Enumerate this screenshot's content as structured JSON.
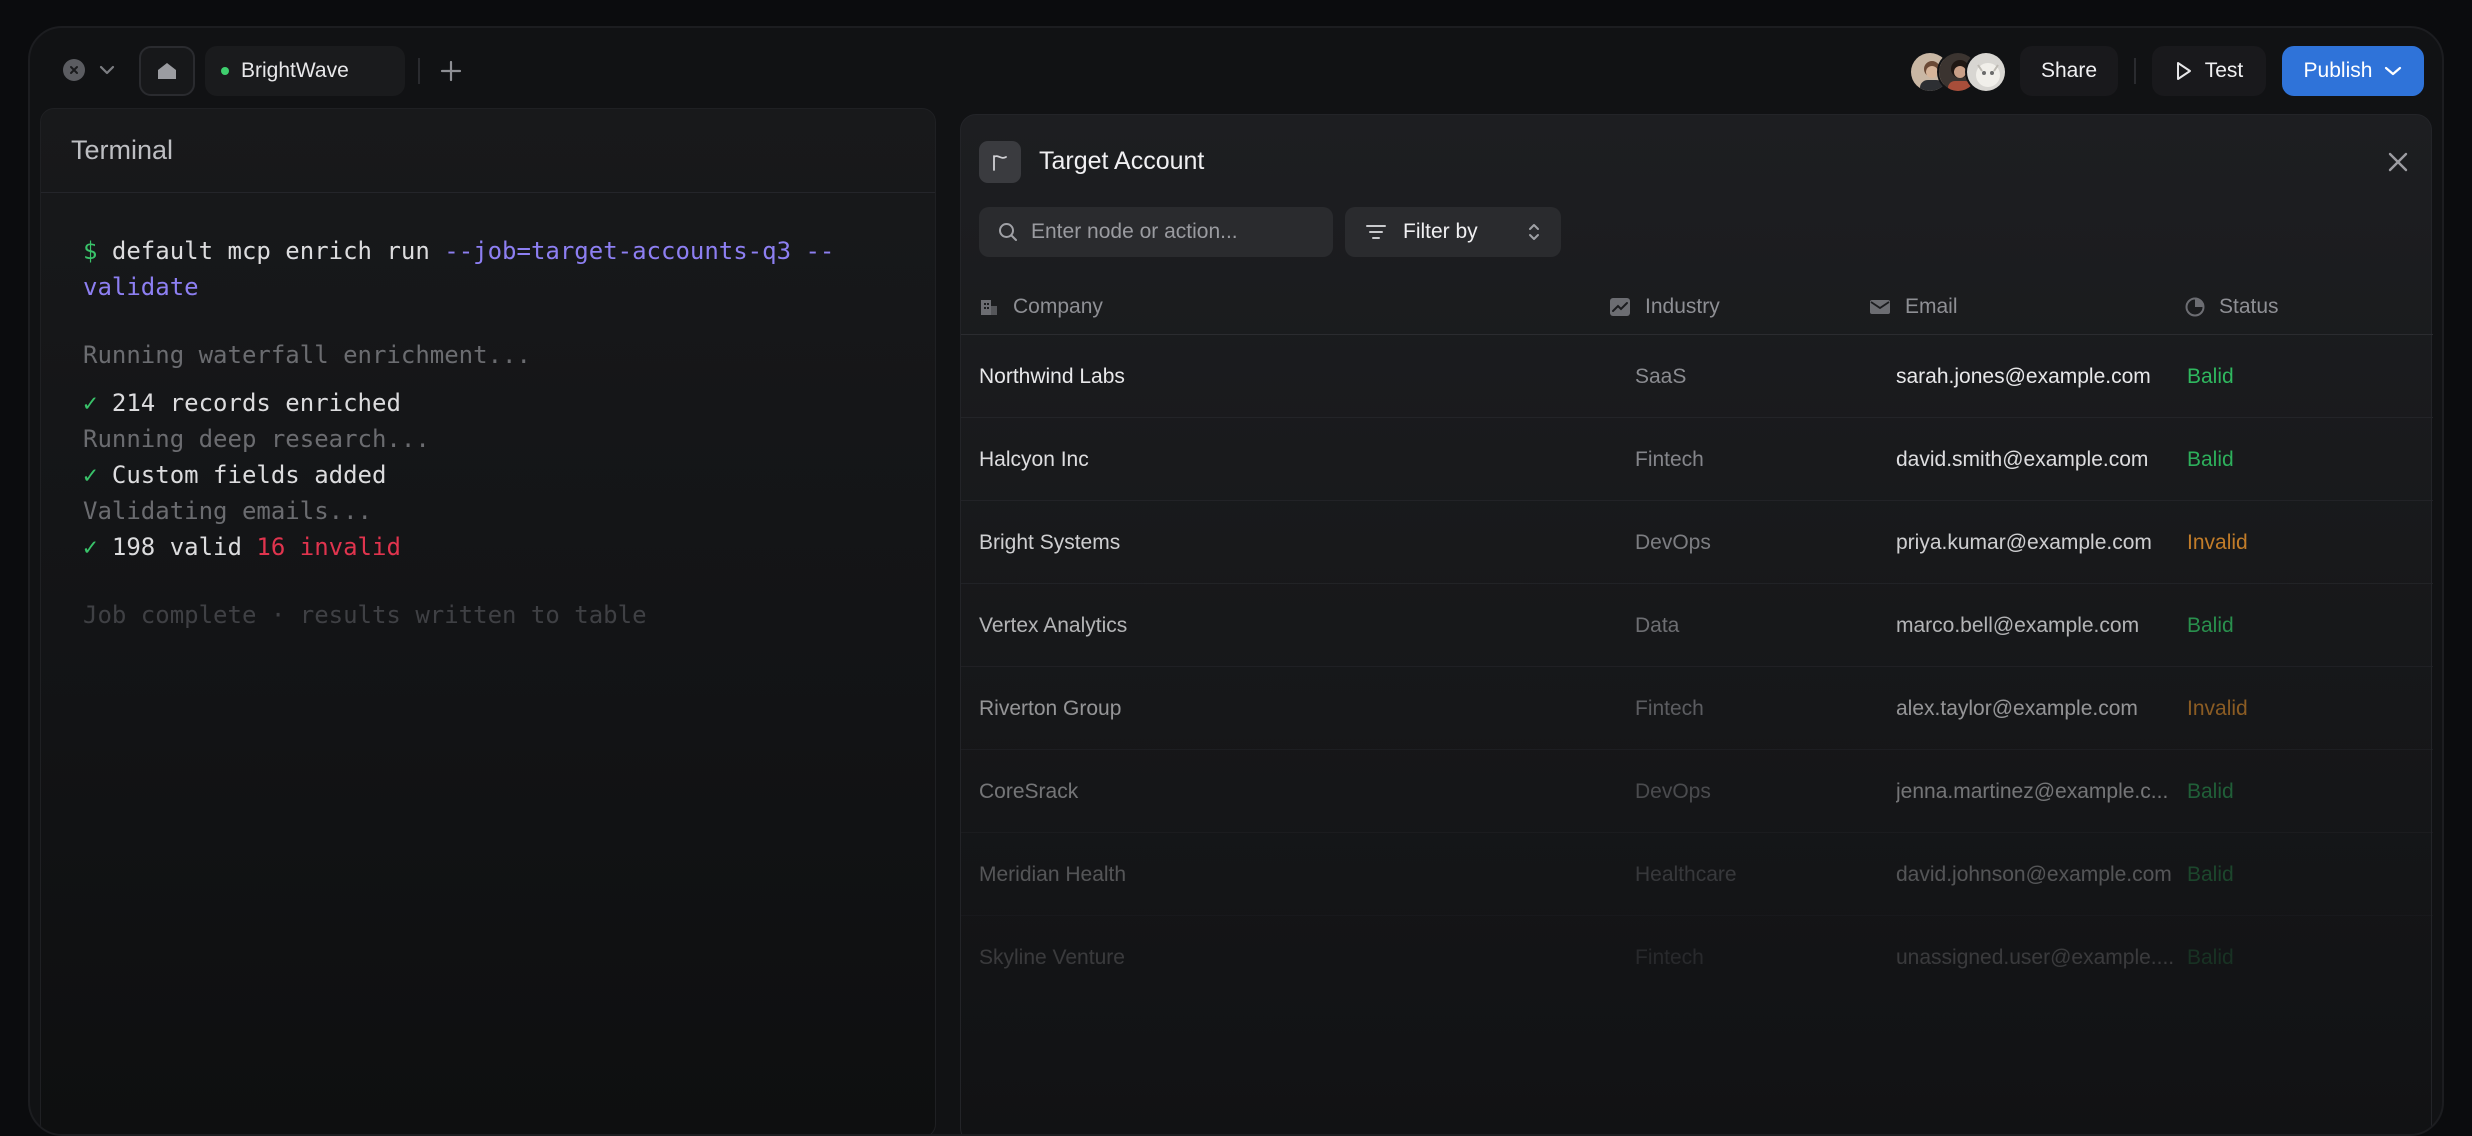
{
  "titlebar": {
    "tab_label": "BrightWave",
    "share_label": "Share",
    "test_label": "Test",
    "publish_label": "Publish"
  },
  "colors": {
    "accent": "#2f73d9",
    "status_valid": "#2fb85f",
    "status_invalid": "#d98a2b",
    "terminal_prompt": "#39c36a",
    "terminal_flag": "#8d7ff2",
    "terminal_error": "#e0344e"
  },
  "terminal": {
    "title": "Terminal",
    "prompt": "$",
    "command": "default mcp enrich run",
    "command_flags": "--job=target-accounts-q3 --validate",
    "line1": "Running waterfall enrichment...",
    "check1": "214 records enriched",
    "line2": "Running deep research...",
    "check2": "Custom fields added",
    "line3": "Validating emails...",
    "check3_valid": "198 valid",
    "check3_invalid": "16 invalid",
    "footer": "Job complete · results written to table"
  },
  "panel": {
    "title": "Target Account",
    "search_placeholder": "Enter node or action...",
    "filter_label": "Filter by",
    "columns": {
      "company": "Company",
      "industry": "Industry",
      "email": "Email",
      "status": "Status"
    },
    "rows": [
      {
        "company": "Northwind Labs",
        "industry": "SaaS",
        "email": "sarah.jones@example.com",
        "status": "Balid"
      },
      {
        "company": "Halcyon Inc",
        "industry": "Fintech",
        "email": "david.smith@example.com",
        "status": "Balid"
      },
      {
        "company": "Bright Systems",
        "industry": "DevOps",
        "email": "priya.kumar@example.com",
        "status": "Invalid"
      },
      {
        "company": "Vertex Analytics",
        "industry": "Data",
        "email": "marco.bell@example.com",
        "status": "Balid"
      },
      {
        "company": "Riverton Group",
        "industry": "Fintech",
        "email": "alex.taylor@example.com",
        "status": "Invalid"
      },
      {
        "company": "CoreSrack",
        "industry": "DevOps",
        "email": "jenna.martinez@example.c...",
        "status": "Balid"
      },
      {
        "company": "Meridian Health",
        "industry": "Healthcare",
        "email": "david.johnson@example.com",
        "status": "Balid"
      },
      {
        "company": "Skyline Venture",
        "industry": "Fintech",
        "email": "unassigned.user@example....",
        "status": "Balid"
      }
    ]
  }
}
